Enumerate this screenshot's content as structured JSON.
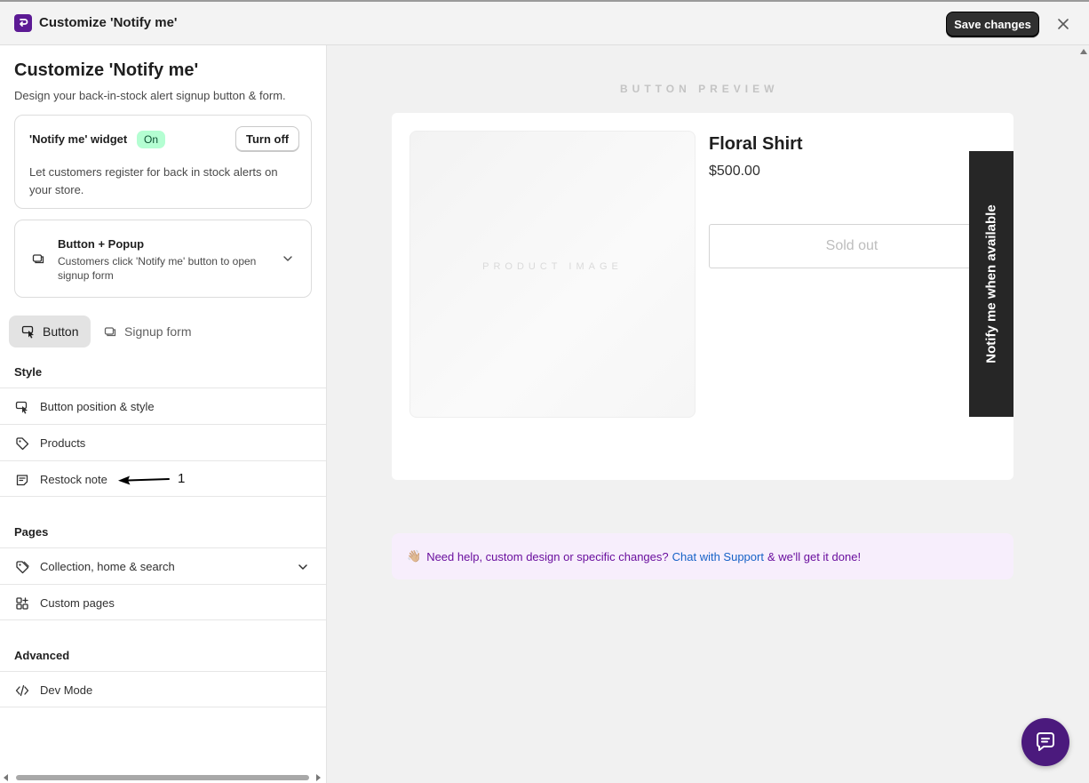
{
  "window": {
    "title": "Customize 'Notify me'",
    "save_label": "Save changes"
  },
  "sidebar": {
    "title": "Customize 'Notify me'",
    "subtitle": "Design your back-in-stock alert signup button & form.",
    "widget": {
      "label": "'Notify me' widget",
      "status": "On",
      "toggle_label": "Turn off",
      "description": "Let customers register for back in stock alerts on your store."
    },
    "mode": {
      "title": "Button + Popup",
      "description": "Customers click 'Notify me' button to open signup form"
    },
    "tabs": [
      {
        "label": "Button",
        "active": true
      },
      {
        "label": "Signup form",
        "active": false
      }
    ],
    "sections": {
      "style": {
        "heading": "Style",
        "items": [
          {
            "label": "Button position & style",
            "icon": "cursor-click-icon"
          },
          {
            "label": "Products",
            "icon": "tag-icon"
          },
          {
            "label": "Restock note",
            "icon": "note-icon"
          }
        ]
      },
      "pages": {
        "heading": "Pages",
        "items": [
          {
            "label": "Collection, home & search",
            "icon": "tag-icon"
          },
          {
            "label": "Custom pages",
            "icon": "apps-icon"
          }
        ]
      },
      "advanced": {
        "heading": "Advanced",
        "items": [
          {
            "label": "Dev Mode",
            "icon": "code-icon"
          }
        ]
      }
    },
    "annotation": {
      "number": "1"
    }
  },
  "preview": {
    "label": "BUTTON PREVIEW",
    "product": {
      "image_label": "PRODUCT IMAGE",
      "name": "Floral Shirt",
      "price": "$500.00",
      "soldout_label": "Sold out",
      "notify_label": "Notify me when available"
    },
    "help": {
      "emoji": "👋🏼",
      "prefix": "Need help, custom design or specific changes?",
      "link": "Chat with Support",
      "suffix": "& we'll get it done!"
    }
  },
  "colors": {
    "brand": "#5c1a94",
    "on_badge": "#b4fed2",
    "notify_tab": "#262626",
    "help_bg": "#f7eefc",
    "help_text": "#6a0f9e",
    "link": "#1662c7",
    "chat_fab": "#4b1a7d"
  }
}
